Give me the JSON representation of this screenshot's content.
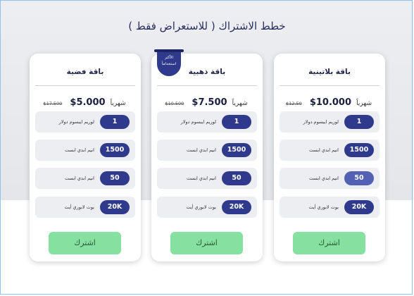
{
  "page": {
    "title": "خطط الاشتراك ( للاستعراض فقط )"
  },
  "plans": [
    {
      "name": "باقة بلاتينية",
      "price": "10.000$",
      "per": "شهرياً",
      "old_price": "12.50$",
      "features": [
        {
          "value": "1",
          "text": "لوريم ايبسوم دولار"
        },
        {
          "value": "1500",
          "text": "انيم ابدي ابست"
        },
        {
          "value": "50",
          "text": "انيم ابدي ابست"
        },
        {
          "value": "20K",
          "text": "بوت لابوري أيت"
        }
      ],
      "button": "اشترك"
    },
    {
      "name": "باقة ذهبية",
      "price": "7.500$",
      "per": "شهرياً",
      "old_price": "10.500$",
      "badge": "الأكثر استخداماً",
      "features": [
        {
          "value": "1",
          "text": "لوريم ايبسوم دولار"
        },
        {
          "value": "1500",
          "text": "انيم ابدي ابست"
        },
        {
          "value": "50",
          "text": "انيم ابدي ابست"
        },
        {
          "value": "20K",
          "text": "بوت لابوري أيت"
        }
      ],
      "button": "اشترك"
    },
    {
      "name": "باقة فضية",
      "price": "5.000$",
      "per": "شهرياً",
      "old_price": "17.500$",
      "features": [
        {
          "value": "1",
          "text": "لوريم ايبسوم دولار"
        },
        {
          "value": "1500",
          "text": "انيم ابدي ابست"
        },
        {
          "value": "50",
          "text": "انيم ابدي ابست"
        },
        {
          "value": "20K",
          "text": "بوت لابوري أيت"
        }
      ],
      "button": "اشترك"
    }
  ],
  "colors": {
    "accent": "#2f3a8d",
    "button": "#86e0a0",
    "title": "#2b2f5d"
  }
}
